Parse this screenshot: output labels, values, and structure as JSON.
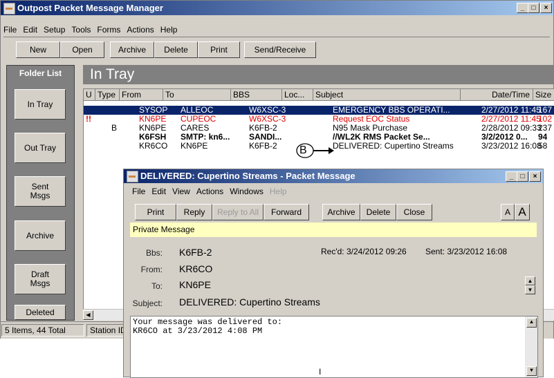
{
  "main": {
    "title": "Outpost Packet Message Manager",
    "menu": [
      "File",
      "Edit",
      "Setup",
      "Tools",
      "Forms",
      "Actions",
      "Help"
    ],
    "toolbar": [
      "New",
      "Open",
      "Archive",
      "Delete",
      "Print",
      "Send/Receive"
    ],
    "folder_header": "Folder List",
    "folders": [
      "In Tray",
      "Out Tray",
      "Sent\nMsgs",
      "Archive",
      "Draft\nMsgs",
      "Deleted"
    ],
    "pane_title": "In Tray",
    "columns": [
      "U",
      "Type",
      "From",
      "To",
      "BBS",
      "Loc...",
      "Subject",
      "Date/Time",
      "Size"
    ],
    "rows": [
      {
        "u": "",
        "type": "",
        "from": "SYSOP",
        "to": "ALLEOC",
        "bbs": "W6XSC-3",
        "loc": "",
        "subject": "EMERGENCY BBS OPERATI...",
        "date": "2/27/2012 11:45",
        "size": "167",
        "style": "selected"
      },
      {
        "u": "!!",
        "type": "",
        "from": "KN6PE",
        "to": "CUPEOC",
        "bbs": "W6XSC-3",
        "loc": "",
        "subject": "Request EOC Status",
        "date": "2/27/2012 11:45",
        "size": "102",
        "style": "red"
      },
      {
        "u": "",
        "type": "B",
        "from": "KN6PE",
        "to": "CARES",
        "bbs": "K6FB-2",
        "loc": "",
        "subject": "N95 Mask Purchase",
        "date": "2/28/2012 09:33",
        "size": "237",
        "style": "normal"
      },
      {
        "u": "",
        "type": "",
        "from": "K6FSH",
        "to": "SMTP: kn6...",
        "bbs": "SANDI...",
        "loc": "",
        "subject": "//WL2K RMS Packet Se...",
        "date": "3/2/2012 0...",
        "size": "94",
        "style": "bold"
      },
      {
        "u": "",
        "type": "",
        "from": "KR6CO",
        "to": "KN6PE",
        "bbs": "K6FB-2",
        "loc": "",
        "subject": "DELIVERED: Cupertino Streams",
        "date": "3/23/2012 16:08",
        "size": "58",
        "style": "normal"
      }
    ],
    "callout_letter": "B",
    "status_items": "5 Items, 44 Total",
    "status_station": "Station ID"
  },
  "msg": {
    "title": "DELIVERED: Cupertino Streams - Packet Message",
    "menu": [
      "File",
      "Edit",
      "View",
      "Actions",
      "Windows",
      "Help"
    ],
    "toolbar": [
      "Print",
      "Reply",
      "Reply to All",
      "Forward",
      "Archive",
      "Delete",
      "Close"
    ],
    "font_small": "A",
    "font_large": "A",
    "private_label": "Private Message",
    "bbs_label": "Bbs:",
    "bbs_value": "K6FB-2",
    "recd": "Rec'd: 3/24/2012 09:26",
    "sent": "Sent: 3/23/2012 16:08",
    "from_label": "From:",
    "from_value": "KR6CO",
    "to_label": "To:",
    "to_value": "KN6PE",
    "subject_label": "Subject:",
    "subject_value": "DELIVERED: Cupertino Streams",
    "body_line1": "Your message was delivered to:",
    "body_line2": "KR6CO at 3/23/2012 4:08 PM"
  },
  "cursor_glyph": "I",
  "colors": {
    "title_active": "#0a246a",
    "selection": "#0a246a",
    "unread_red": "#e00000",
    "private_bar": "#ffffc0",
    "face": "#d4d0c8"
  }
}
